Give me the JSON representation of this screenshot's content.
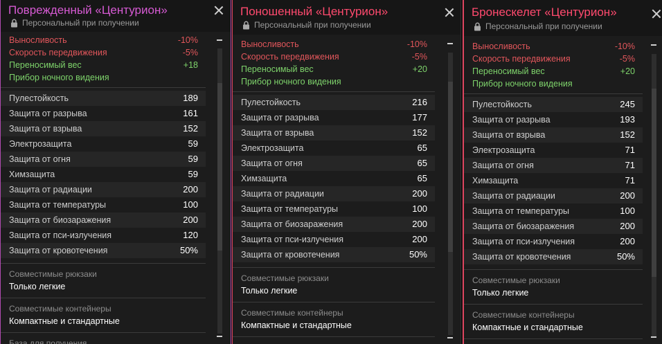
{
  "panels": [
    {
      "title": "Поврежденный «Центурион»",
      "title_color": "#d65ad3",
      "subtitle": "Персональный при получении",
      "modifiers": [
        {
          "label": "Выносливость",
          "value": "-10%",
          "kind": "neg"
        },
        {
          "label": "Скорость передвижения",
          "value": "-5%",
          "kind": "neg"
        },
        {
          "label": "Переносимый вес",
          "value": "+18",
          "kind": "pos"
        },
        {
          "label": "Прибор ночного видения",
          "value": "",
          "kind": "pos"
        }
      ],
      "stats": [
        {
          "label": "Пулестойкость",
          "value": "189"
        },
        {
          "label": "Защита от разрыва",
          "value": "161"
        },
        {
          "label": "Защита от взрыва",
          "value": "152"
        },
        {
          "label": "Электрозащита",
          "value": "59"
        },
        {
          "label": "Защита от огня",
          "value": "59"
        },
        {
          "label": "Химзащита",
          "value": "59"
        },
        {
          "label": "Защита от радиации",
          "value": "200"
        },
        {
          "label": "Защита от температуры",
          "value": "100"
        },
        {
          "label": "Защита от биозаражения",
          "value": "200"
        },
        {
          "label": "Защита от пси-излучения",
          "value": "120"
        },
        {
          "label": "Защита от кровотечения",
          "value": "50%"
        }
      ],
      "sections": [
        {
          "label": "Совместимые рюкзаки",
          "value": "Только легкие"
        },
        {
          "label": "Совместимые контейнеры",
          "value": "Компактные и стандартные"
        },
        {
          "label": "База для получения",
          "value": ""
        }
      ]
    },
    {
      "title": "Поношенный «Центурион»",
      "title_color": "#ff4a6e",
      "subtitle": "Персональный при получении",
      "modifiers": [
        {
          "label": "Выносливость",
          "value": "-10%",
          "kind": "neg"
        },
        {
          "label": "Скорость передвижения",
          "value": "-5%",
          "kind": "neg"
        },
        {
          "label": "Переносимый вес",
          "value": "+20",
          "kind": "pos"
        },
        {
          "label": "Прибор ночного видения",
          "value": "",
          "kind": "pos"
        }
      ],
      "stats": [
        {
          "label": "Пулестойкость",
          "value": "216"
        },
        {
          "label": "Защита от разрыва",
          "value": "177"
        },
        {
          "label": "Защита от взрыва",
          "value": "152"
        },
        {
          "label": "Электрозащита",
          "value": "65"
        },
        {
          "label": "Защита от огня",
          "value": "65"
        },
        {
          "label": "Химзащита",
          "value": "65"
        },
        {
          "label": "Защита от радиации",
          "value": "200"
        },
        {
          "label": "Защита от температуры",
          "value": "100"
        },
        {
          "label": "Защита от биозаражения",
          "value": "200"
        },
        {
          "label": "Защита от пси-излучения",
          "value": "200"
        },
        {
          "label": "Защита от кровотечения",
          "value": "50%"
        }
      ],
      "sections": [
        {
          "label": "Совместимые рюкзаки",
          "value": "Только легкие"
        },
        {
          "label": "Совместимые контейнеры",
          "value": "Компактные и стандартные"
        }
      ]
    },
    {
      "title": "Бронескелет «Центурион»",
      "title_color": "#ff4a6e",
      "subtitle": "Персональный при получении",
      "modifiers": [
        {
          "label": "Выносливость",
          "value": "-10%",
          "kind": "neg"
        },
        {
          "label": "Скорость передвижения",
          "value": "-5%",
          "kind": "neg"
        },
        {
          "label": "Переносимый вес",
          "value": "+20",
          "kind": "pos"
        },
        {
          "label": "Прибор ночного видения",
          "value": "",
          "kind": "pos"
        }
      ],
      "stats": [
        {
          "label": "Пулестойкость",
          "value": "245"
        },
        {
          "label": "Защита от разрыва",
          "value": "193"
        },
        {
          "label": "Защита от взрыва",
          "value": "152"
        },
        {
          "label": "Электрозащита",
          "value": "71"
        },
        {
          "label": "Защита от огня",
          "value": "71"
        },
        {
          "label": "Химзащита",
          "value": "71"
        },
        {
          "label": "Защита от радиации",
          "value": "200"
        },
        {
          "label": "Защита от температуры",
          "value": "100"
        },
        {
          "label": "Защита от биозаражения",
          "value": "200"
        },
        {
          "label": "Защита от пси-излучения",
          "value": "200"
        },
        {
          "label": "Защита от кровотечения",
          "value": "50%"
        }
      ],
      "sections": [
        {
          "label": "Совместимые рюкзаки",
          "value": "Только легкие"
        },
        {
          "label": "Совместимые контейнеры",
          "value": "Компактные и стандартные"
        }
      ]
    }
  ]
}
